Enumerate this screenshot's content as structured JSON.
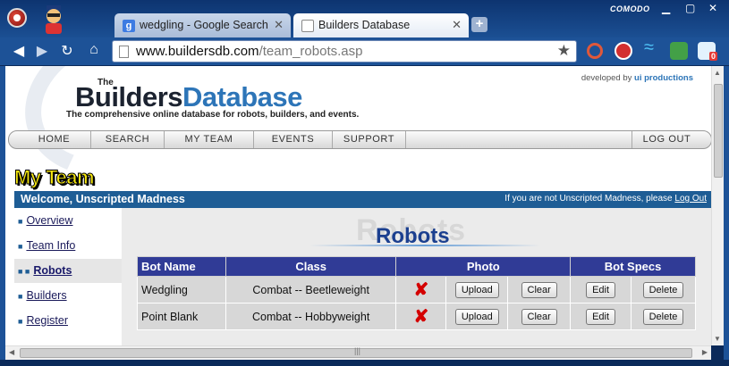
{
  "browser": {
    "brand": "COMODO",
    "tabs": [
      {
        "favicon": "g",
        "title": "wedgling - Google Search"
      },
      {
        "favicon": "",
        "title": "Builders Database"
      }
    ],
    "close_glyph": "✕",
    "new_tab_glyph": "+",
    "url_host": "www.buildersdb.com",
    "url_path": "/team_robots.asp",
    "ext_badge": "0"
  },
  "site": {
    "logo_the": "The",
    "logo_builders": "Builders",
    "logo_database": "Database",
    "tagline": "The comprehensive online database for robots, builders, and events.",
    "dev_prefix": "developed by",
    "dev_name": "ui productions",
    "nav": {
      "home": "HOME",
      "search": "SEARCH",
      "my_team": "MY TEAM",
      "events": "EVENTS",
      "support": "SUPPORT",
      "logout": "LOG OUT"
    }
  },
  "team": {
    "title": "My Team",
    "welcome": "Welcome, Unscripted Madness",
    "not_user_text": "If you are not Unscripted Madness, please",
    "not_user_link": "Log Out",
    "menu": [
      "Overview",
      "Team Info",
      "Robots",
      "Builders",
      "Register"
    ],
    "active_item": "Robots"
  },
  "robots": {
    "title": "Robots",
    "title_shadow": "Robots",
    "columns": [
      "Bot Name",
      "Class",
      "Photo",
      "Bot Specs"
    ],
    "rows": [
      {
        "name": "Wedgling",
        "class": "Combat -- Beetleweight",
        "photo_status": "✘",
        "upload": "Upload",
        "clear": "Clear",
        "edit": "Edit",
        "delete": "Delete"
      },
      {
        "name": "Point Blank",
        "class": "Combat -- Hobbyweight",
        "photo_status": "✘",
        "upload": "Upload",
        "clear": "Clear",
        "edit": "Edit",
        "delete": "Delete"
      }
    ]
  },
  "colors": {
    "header_blue": "#303b96",
    "welcome_blue": "#1e5d95",
    "title_yellow": "#f5e60f",
    "missing_red": "#d40000"
  }
}
